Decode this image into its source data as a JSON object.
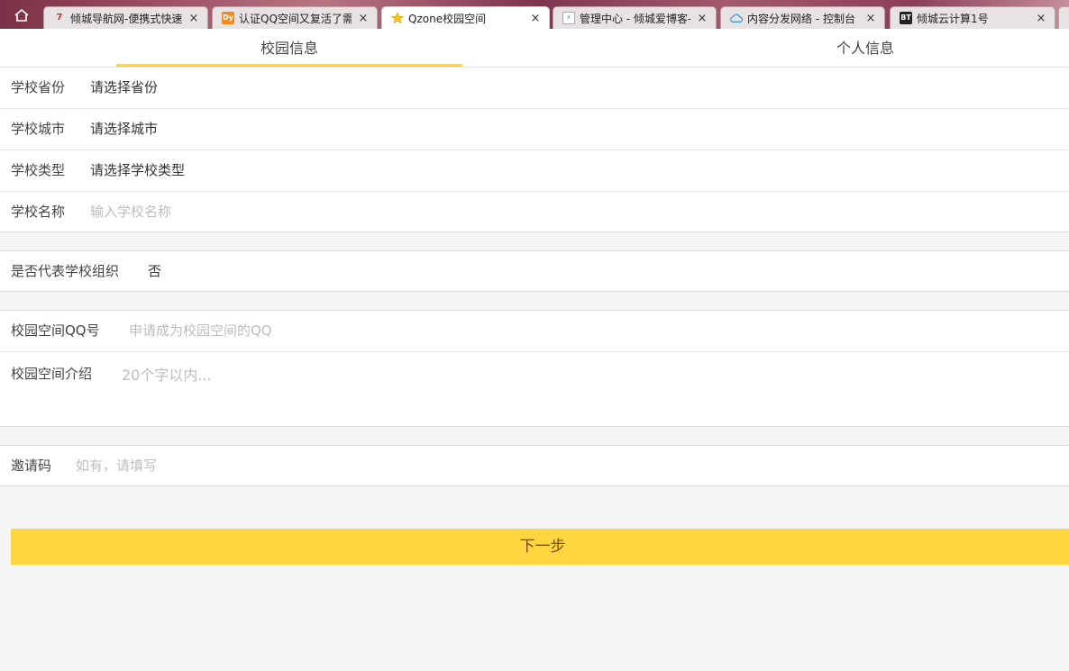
{
  "browser": {
    "tabs": [
      {
        "title": "倾城导航网-便携式快速导航",
        "favicon": "7"
      },
      {
        "title": "认证QQ空间又复活了需要",
        "favicon": "Dy"
      },
      {
        "title": "Qzone校园空间",
        "favicon": "star"
      },
      {
        "title": "管理中心 - 倾城爱博客-",
        "favicon": "blog"
      },
      {
        "title": "内容分发网络 - 控制台",
        "favicon": "cloud"
      },
      {
        "title": "倾城云计算1号",
        "favicon": "BT"
      }
    ],
    "active_tab_index": 2
  },
  "page": {
    "tabs": [
      {
        "label": "校园信息",
        "active": true
      },
      {
        "label": "个人信息",
        "active": false
      }
    ],
    "school_section": [
      {
        "label": "学校省份",
        "value": "请选择省份",
        "is_placeholder": false
      },
      {
        "label": "学校城市",
        "value": "请选择城市",
        "is_placeholder": false
      },
      {
        "label": "学校类型",
        "value": "请选择学校类型",
        "is_placeholder": false
      },
      {
        "label": "学校名称",
        "value": "输入学校名称",
        "is_placeholder": true
      }
    ],
    "org": {
      "label": "是否代表学校组织",
      "value": "否"
    },
    "qq": {
      "label": "校园空间QQ号",
      "placeholder": "申请成为校园空间的QQ"
    },
    "intro": {
      "label": "校园空间介绍",
      "placeholder": "20个字以内..."
    },
    "invite": {
      "label": "邀请码",
      "placeholder": "如有，请填写"
    },
    "next_button": "下一步"
  },
  "colors": {
    "accent": "#ffd640",
    "button_text": "#7a4a10",
    "placeholder": "#bdbdbd",
    "background": "#f4f4f4"
  }
}
